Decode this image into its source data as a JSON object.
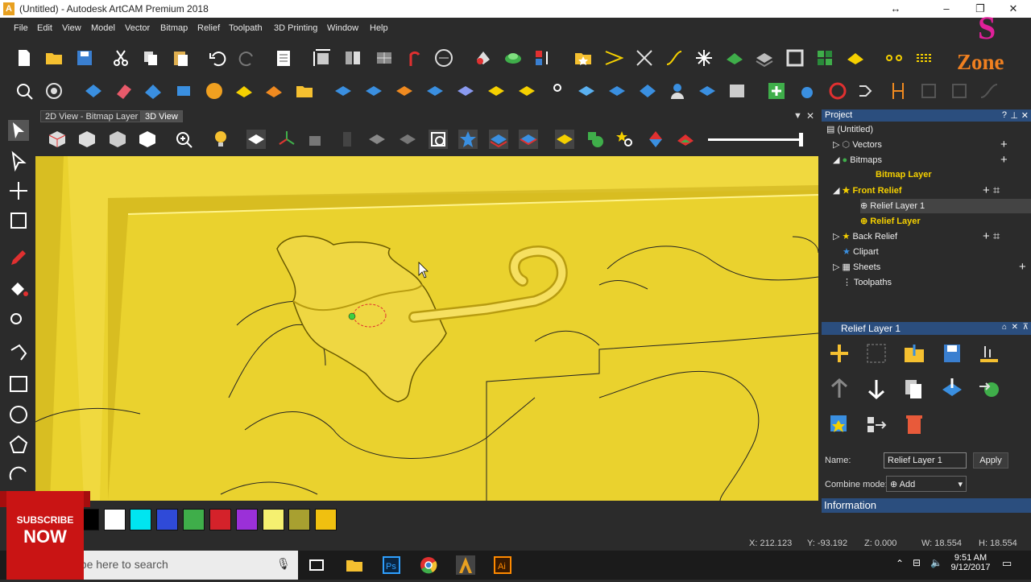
{
  "window": {
    "title": "(Untitled) - Autodesk ArtCAM Premium 2018",
    "app_icon_letter": "A"
  },
  "menu": [
    "File",
    "Edit",
    "View",
    "Model",
    "Vector",
    "Bitmap",
    "Relief",
    "Toolpath",
    "3D Printing",
    "Window",
    "Help"
  ],
  "tabs": [
    "2D View - Bitmap Layer",
    "3D View"
  ],
  "project": {
    "header": "Project",
    "items": [
      {
        "label": "(Untitled)"
      },
      {
        "label": "Vectors"
      },
      {
        "label": "Bitmaps"
      },
      {
        "label": "Bitmap Layer"
      },
      {
        "label": "Front Relief"
      },
      {
        "label": "Relief Layer 1"
      },
      {
        "label": "Relief Layer"
      },
      {
        "label": "Back Relief"
      },
      {
        "label": "Clipart"
      },
      {
        "label": "Sheets"
      },
      {
        "label": "Toolpaths"
      }
    ]
  },
  "layer_panel": {
    "header": "Relief Layer 1",
    "name_label": "Name:",
    "name_value": "Relief Layer 1",
    "apply_label": "Apply",
    "combine_label": "Combine mode:",
    "combine_value": "Add"
  },
  "information": {
    "header": "Information"
  },
  "palette": {
    "colors": [
      "#000000",
      "#ffffff",
      "#00e5f0",
      "#2f4ad8",
      "#3fae4a",
      "#d4222a",
      "#9b30d8",
      "#f5f070",
      "#a8a030",
      "#f0c010"
    ]
  },
  "status": {
    "x": "X: 212.123",
    "y": "Y: -93.192",
    "z": "Z: 0.000",
    "w": "W: 18.554",
    "h": "H: 18.554"
  },
  "taskbar": {
    "search_placeholder": "Type here to search",
    "time": "9:51 AM",
    "date": "9/12/2017"
  },
  "overlay": {
    "subscribe": "SUBSCRIBE",
    "now": "NOW",
    "brand": "Zone",
    "brand_letter": "S"
  }
}
